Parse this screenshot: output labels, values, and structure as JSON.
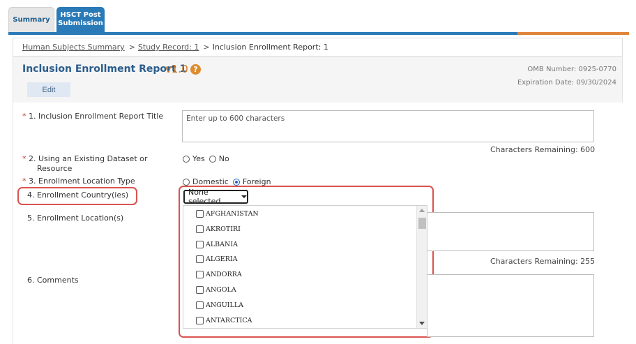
{
  "tabs": {
    "summary": "Summary",
    "hsct_line1": "HSCT Post",
    "hsct_line2": "Submission"
  },
  "breadcrumb": {
    "item1": "Human Subjects Summary",
    "item2": "Study Record: 1",
    "item3": "Inclusion Enrollment Report: 1",
    "separator": ">"
  },
  "header": {
    "title": "Inclusion Enrollment Report 1",
    "version": "v1.0",
    "help": "?",
    "omb_number": "OMB Number: 0925-0770",
    "expiration": "Expiration Date: 09/30/2024",
    "edit_label": "Edit"
  },
  "form": {
    "required_mark": "*",
    "q1": {
      "label": "1. Inclusion Enrollment Report Title",
      "placeholder": "Enter up to 600 characters",
      "chars_remaining": "Characters Remaining: 600"
    },
    "q2": {
      "label_line1": "2. Using an Existing Dataset or",
      "label_line2": "Resource",
      "options": [
        "Yes",
        "No"
      ]
    },
    "q3": {
      "label": "3. Enrollment Location Type",
      "options": [
        "Domestic",
        "Foreign"
      ],
      "selected": "Foreign"
    },
    "q4": {
      "label": "4. Enrollment Country(ies)",
      "dropdown_value": "None selected",
      "countries": [
        "AFGHANISTAN",
        "AKROTIRI",
        "ALBANIA",
        "ALGERIA",
        "ANDORRA",
        "ANGOLA",
        "ANGUILLA",
        "ANTARCTICA"
      ]
    },
    "q5": {
      "label": "5. Enrollment Location(s)",
      "chars_remaining": "Characters Remaining: 255"
    },
    "q6": {
      "label": "6. Comments"
    }
  },
  "colors": {
    "tab_active": "#2a7ab8",
    "accent_orange": "#e0843a",
    "title_blue": "#2b5d8c",
    "highlight_red": "#d9534f",
    "required_red": "#c0392b"
  }
}
